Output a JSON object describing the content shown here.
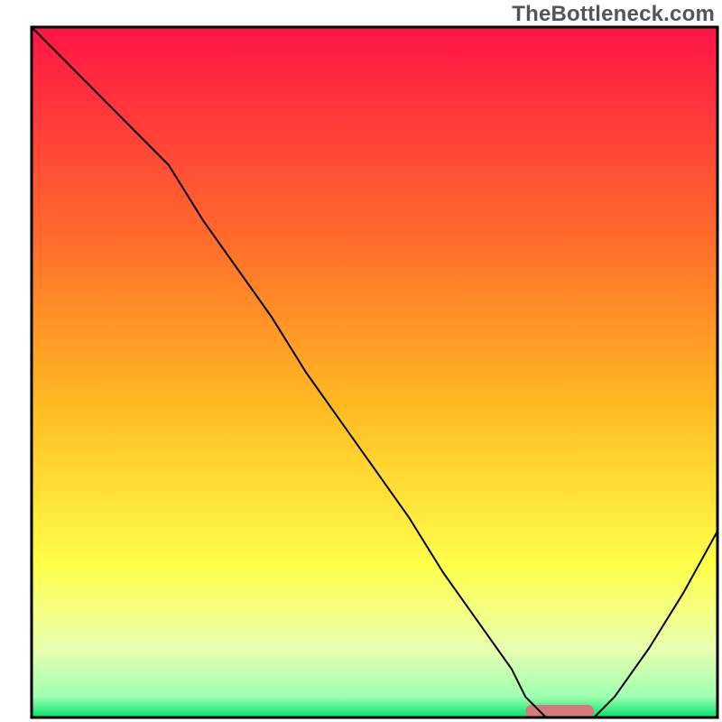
{
  "watermark": "TheBottleneck.com",
  "chart_data": {
    "type": "line",
    "title": "",
    "xlabel": "",
    "ylabel": "",
    "xlim": [
      0,
      100
    ],
    "ylim": [
      0,
      100
    ],
    "grid": false,
    "legend": false,
    "x": [
      0,
      5,
      10,
      15,
      20,
      25,
      30,
      35,
      40,
      45,
      50,
      55,
      60,
      65,
      70,
      72,
      75,
      80,
      82,
      85,
      90,
      95,
      100
    ],
    "values": [
      100,
      95,
      90,
      85,
      80,
      72,
      65,
      58,
      50,
      43,
      36,
      29,
      21,
      14,
      7,
      3,
      0,
      0,
      0,
      3,
      10,
      18,
      27
    ],
    "marker": {
      "x_start": 72,
      "x_end": 82,
      "color": "#d47a7a"
    },
    "gradient_stops": [
      {
        "offset": 0.0,
        "color": "#ff1445"
      },
      {
        "offset": 0.3,
        "color": "#ff6a2c"
      },
      {
        "offset": 0.55,
        "color": "#ffbb22"
      },
      {
        "offset": 0.78,
        "color": "#ffff4a"
      },
      {
        "offset": 0.9,
        "color": "#e9ffb0"
      },
      {
        "offset": 0.97,
        "color": "#9fffb0"
      },
      {
        "offset": 1.0,
        "color": "#00e26b"
      }
    ],
    "frame_color": "#000000",
    "line_color": "#000000",
    "line_width": 2
  }
}
